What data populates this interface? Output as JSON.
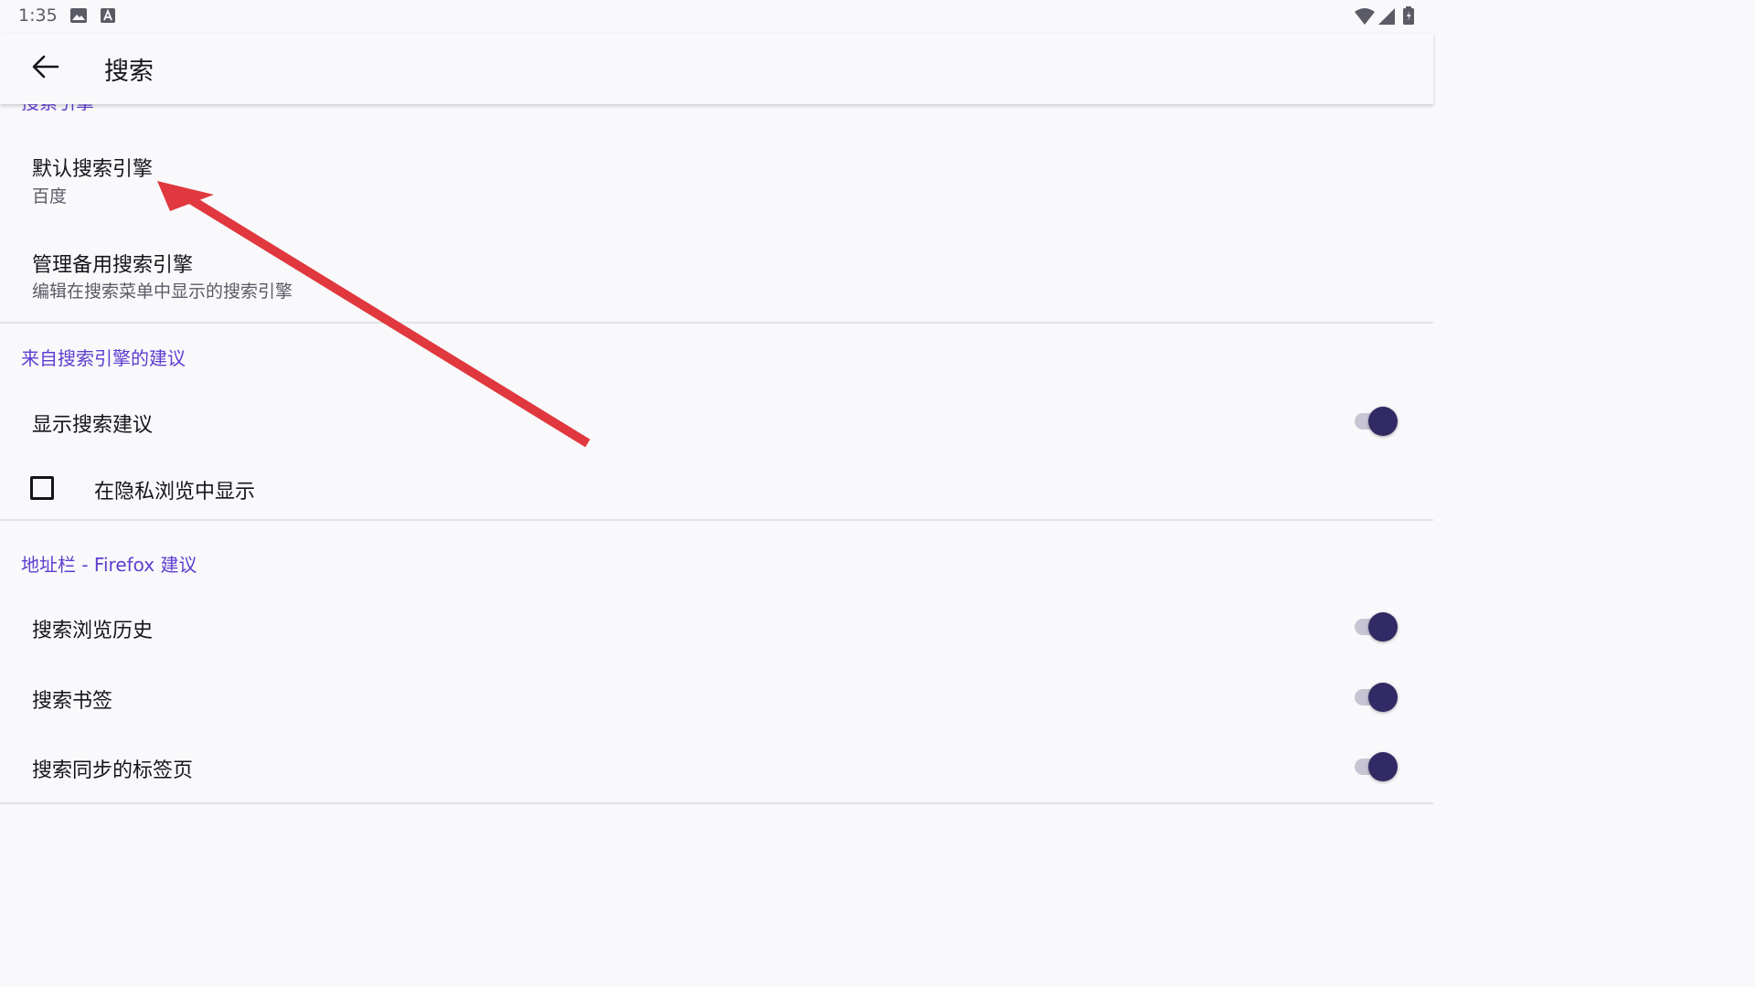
{
  "status": {
    "time": "1:35",
    "left_icons": [
      "image-icon",
      "a-icon"
    ],
    "right_icons": [
      "wifi-icon",
      "signal-icon",
      "battery-icon"
    ]
  },
  "app_bar": {
    "back_icon": "arrow-left-icon",
    "title": "搜索"
  },
  "sections": {
    "search_engine": {
      "header_cut": "搜索引擎",
      "default_engine": {
        "title": "默认搜索引擎",
        "summary": "百度"
      },
      "manage_alt": {
        "title": "管理备用搜索引擎",
        "summary": "编辑在搜索菜单中显示的搜索引擎"
      }
    },
    "suggestions": {
      "header": "来自搜索引擎的建议",
      "show_suggestions": {
        "label": "显示搜索建议",
        "enabled": true
      },
      "private_browsing": {
        "label": "在隐私浏览中显示",
        "checked": false
      }
    },
    "address_bar": {
      "header": "地址栏 - Firefox 建议",
      "history": {
        "label": "搜索浏览历史",
        "enabled": true
      },
      "bookmarks": {
        "label": "搜索书签",
        "enabled": true
      },
      "synced_tabs": {
        "label": "搜索同步的标签页",
        "enabled": true
      }
    }
  },
  "colors": {
    "accent": "#5e3ed0",
    "switch_thumb": "#312a64",
    "switch_track": "#c6c5d3",
    "annotation_arrow": "#e0383e"
  }
}
